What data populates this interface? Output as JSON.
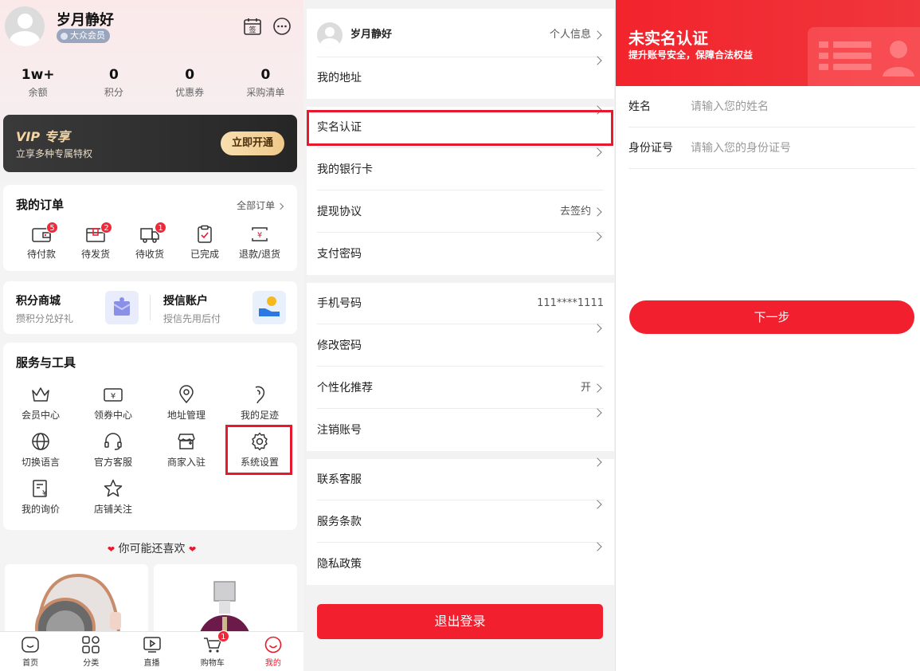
{
  "profile": {
    "username": "岁月静好",
    "member_level": "大众会员",
    "calendar_label": "签",
    "stats": [
      {
        "value": "1w+",
        "label": "余额"
      },
      {
        "value": "0",
        "label": "积分"
      },
      {
        "value": "0",
        "label": "优惠券"
      },
      {
        "value": "0",
        "label": "采购清单"
      }
    ],
    "vip": {
      "title": "VIP 专享",
      "subtitle": "立享多种专属特权",
      "button": "立即开通"
    },
    "orders": {
      "title": "我的订单",
      "more": "全部订单",
      "items": [
        {
          "label": "待付款",
          "badge": "5",
          "icon": "wallet-icon"
        },
        {
          "label": "待发货",
          "badge": "2",
          "icon": "package-icon"
        },
        {
          "label": "待收货",
          "badge": "1",
          "icon": "truck-icon"
        },
        {
          "label": "已完成",
          "badge": "",
          "icon": "clipboard-check-icon"
        },
        {
          "label": "退款/退货",
          "badge": "",
          "icon": "refund-icon"
        }
      ]
    },
    "points_mall": {
      "title": "积分商城",
      "subtitle": "攒积分兑好礼"
    },
    "credit_account": {
      "title": "授信账户",
      "subtitle": "授信先用后付"
    },
    "services": {
      "title": "服务与工具",
      "items": [
        {
          "label": "会员中心",
          "icon": "crown-icon"
        },
        {
          "label": "领券中心",
          "icon": "coupon-icon"
        },
        {
          "label": "地址管理",
          "icon": "location-pin-icon"
        },
        {
          "label": "我的足迹",
          "icon": "footprint-icon"
        },
        {
          "label": "切换语言",
          "icon": "globe-icon"
        },
        {
          "label": "官方客服",
          "icon": "headset-icon"
        },
        {
          "label": "商家入驻",
          "icon": "store-icon"
        },
        {
          "label": "系统设置",
          "icon": "gear-icon"
        },
        {
          "label": "我的询价",
          "icon": "inquiry-icon"
        },
        {
          "label": "店铺关注",
          "icon": "star-icon"
        }
      ]
    },
    "recommend_title": "你可能还喜欢",
    "tabbar": [
      {
        "label": "首页",
        "icon": "home-icon"
      },
      {
        "label": "分类",
        "icon": "category-icon"
      },
      {
        "label": "直播",
        "icon": "live-icon"
      },
      {
        "label": "购物车",
        "icon": "cart-icon",
        "badge": "1"
      },
      {
        "label": "我的",
        "icon": "profile-icon"
      }
    ]
  },
  "settings": {
    "user_row": {
      "name": "岁月静好",
      "right": "个人信息"
    },
    "address": "我的地址",
    "real_name": "实名认证",
    "bank_card": "我的银行卡",
    "withdraw": {
      "label": "提现协议",
      "right": "去签约"
    },
    "pay_password": "支付密码",
    "phone": {
      "label": "手机号码",
      "right": "111****1111"
    },
    "change_password": "修改密码",
    "personalized": {
      "label": "个性化推荐",
      "right": "开"
    },
    "cancel_account": "注销账号",
    "contact_service": "联系客服",
    "terms": "服务条款",
    "privacy": "隐私政策",
    "logout": "退出登录"
  },
  "verify": {
    "title": "未实名认证",
    "subtitle": "提升账号安全，保障合法权益",
    "name_label": "姓名",
    "name_placeholder": "请输入您的姓名",
    "id_label": "身份证号",
    "id_placeholder": "请输入您的身份证号",
    "next": "下一步"
  },
  "colors": {
    "accent": "#f2202e",
    "highlight_box": "#e8192c",
    "vip_gold": "#f3d6a3"
  }
}
